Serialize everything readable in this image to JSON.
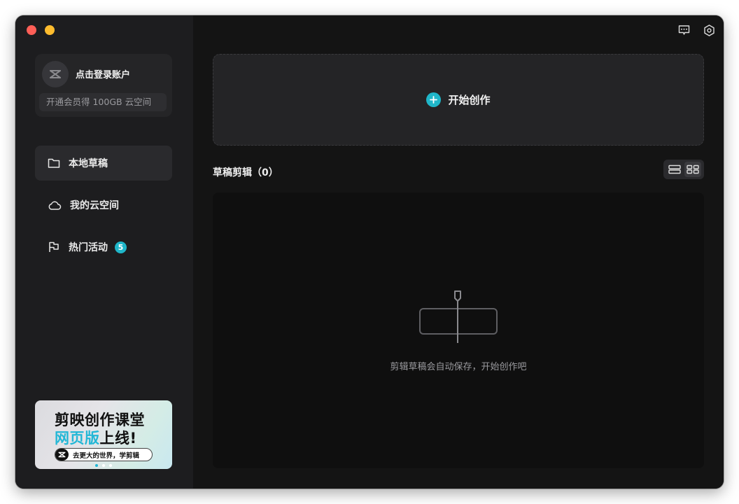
{
  "sidebar": {
    "account": {
      "login_label": "点击登录账户",
      "vip_text": "开通会员得 100GB 云空间"
    },
    "nav": [
      {
        "label": "本地草稿",
        "icon": "folder-icon",
        "active": true
      },
      {
        "label": "我的云空间",
        "icon": "cloud-icon",
        "active": false
      },
      {
        "label": "热门活动",
        "icon": "flag-icon",
        "active": false,
        "badge": "5"
      }
    ],
    "banner": {
      "line1": "剪映创作课堂",
      "line2_highlight": "网页版",
      "line2_rest": "上线!",
      "pill_text": "去更大的世界，学剪辑"
    }
  },
  "main": {
    "start_label": "开始创作",
    "section_title": "草稿剪辑（0）",
    "empty_text": "剪辑草稿会自动保存，开始创作吧"
  },
  "colors": {
    "accent": "#1fb6c9",
    "sidebar_bg": "#1d1d1f",
    "main_bg": "#141414",
    "card_bg": "#242426"
  }
}
